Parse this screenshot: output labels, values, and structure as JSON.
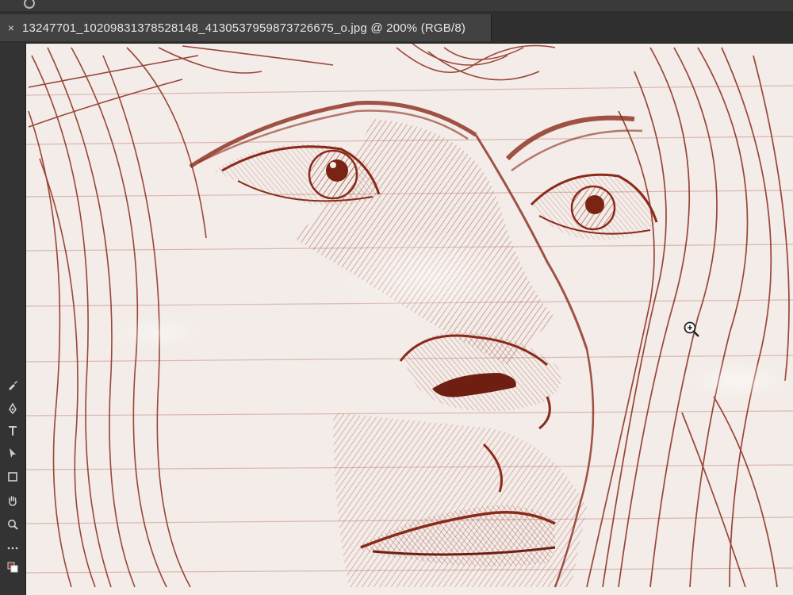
{
  "document": {
    "tab_title": "13247701_10209831378528148_4130537959873726675_o.jpg @ 200% (RGB/8)",
    "close_symbol": "×"
  },
  "toolbar": {
    "tools": [
      {
        "name": "brush-tool-icon"
      },
      {
        "name": "pen-tool-icon"
      },
      {
        "name": "type-tool-icon"
      },
      {
        "name": "path-selection-tool-icon"
      },
      {
        "name": "rectangle-tool-icon"
      },
      {
        "name": "hand-tool-icon"
      },
      {
        "name": "zoom-tool-icon"
      },
      {
        "name": "more-tools-icon"
      },
      {
        "name": "default-colors-icon"
      }
    ]
  },
  "colors": {
    "ink": "#8a2a1a",
    "paper": "#f3ece8",
    "ruled_line": "#d9b8b0",
    "chrome": "#2f2f2f"
  },
  "cursor": {
    "icon": "zoom-in-cursor-icon"
  }
}
